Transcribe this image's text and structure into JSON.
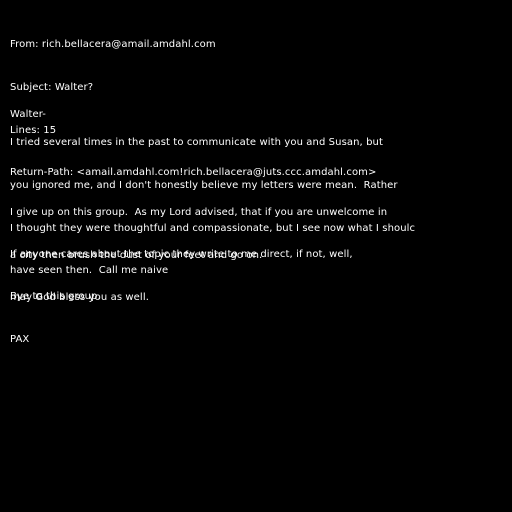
{
  "headers": {
    "from": "From: rich.bellacera@amail.amdahl.com",
    "subject": "Subject: Walter?",
    "lines": "Lines: 15",
    "return_path": "Return-Path: <amail.amdahl.com!rich.bellacera@juts.ccc.amdahl.com>"
  },
  "body": {
    "greeting": "Walter-",
    "paragraph1": [
      "I tried several times in the past to communicate with you and Susan, but",
      "you ignored me, and I don't honestly believe my letters were mean.  Rather",
      "I thought they were thoughtful and compassionate, but I see now what I shoulc",
      "have seen then.  Call me naive"
    ],
    "paragraph2": [
      "I give up on this group.  As my Lord advised, that if you are unwelcome in",
      "a city then brush the dust of your feet and go on."
    ],
    "paragraph3": [
      "If anyone cares about the topic they write to me direct, if not, well,",
      "may God bless you as well."
    ],
    "closing": [
      "Bye to this group.",
      "PAX"
    ]
  },
  "colors": {
    "background": "#000000",
    "text": "#ffffff"
  }
}
